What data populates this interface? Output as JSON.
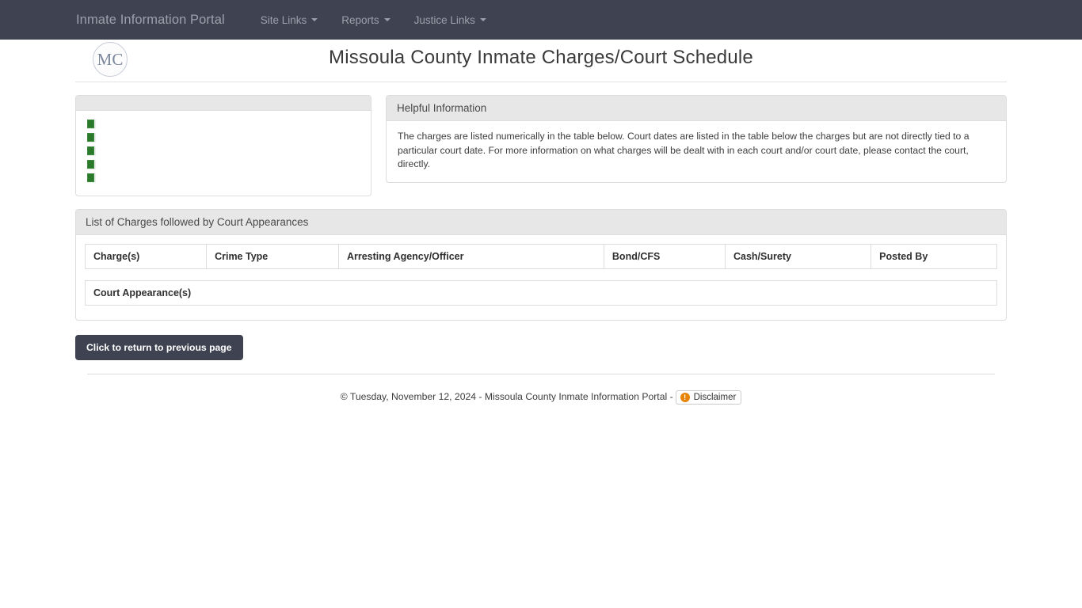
{
  "navbar": {
    "brand": "Inmate Information Portal",
    "items": [
      {
        "label": "Site Links"
      },
      {
        "label": "Reports"
      },
      {
        "label": "Justice Links"
      }
    ]
  },
  "header": {
    "logo_text": "MC",
    "title": "Missoula County Inmate Charges/Court Schedule"
  },
  "left_panel": {
    "heading": "",
    "rows": [
      {
        "icon": "green-square-icon",
        "label": ""
      },
      {
        "icon": "green-square-icon",
        "label": ""
      },
      {
        "icon": "green-square-icon",
        "label": ""
      },
      {
        "icon": "green-square-icon",
        "label": ""
      },
      {
        "icon": "green-square-icon",
        "label": ""
      }
    ]
  },
  "helpful_information": {
    "heading": "Helpful Information",
    "body": "The charges are listed numerically in the table below. Court dates are listed in the table below the charges but are not directly tied to a particular court date. For more information on what charges will be dealt with in each court and/or court date, please contact the court, directly."
  },
  "charges_panel": {
    "heading": "List of Charges followed by Court Appearances",
    "columns": [
      "Charge(s)",
      "Crime Type",
      "Arresting Agency/Officer",
      "Bond/CFS",
      "Cash/Surety",
      "Posted By"
    ],
    "rows": [],
    "court_appearances_heading": "Court Appearance(s)",
    "court_appearances_rows": []
  },
  "actions": {
    "return_button": "Click to return to previous page"
  },
  "footer": {
    "copyright": "© Tuesday, November 12, 2024 - Missoula County Inmate Information Portal -",
    "disclaimer_label": "Disclaimer",
    "warn_glyph": "!"
  },
  "colors": {
    "navbar_bg": "#3f4351",
    "panel_heading_bg": "#e7e7e7",
    "accent_green": "#2b7a2b",
    "warn_orange": "#e8840a"
  }
}
